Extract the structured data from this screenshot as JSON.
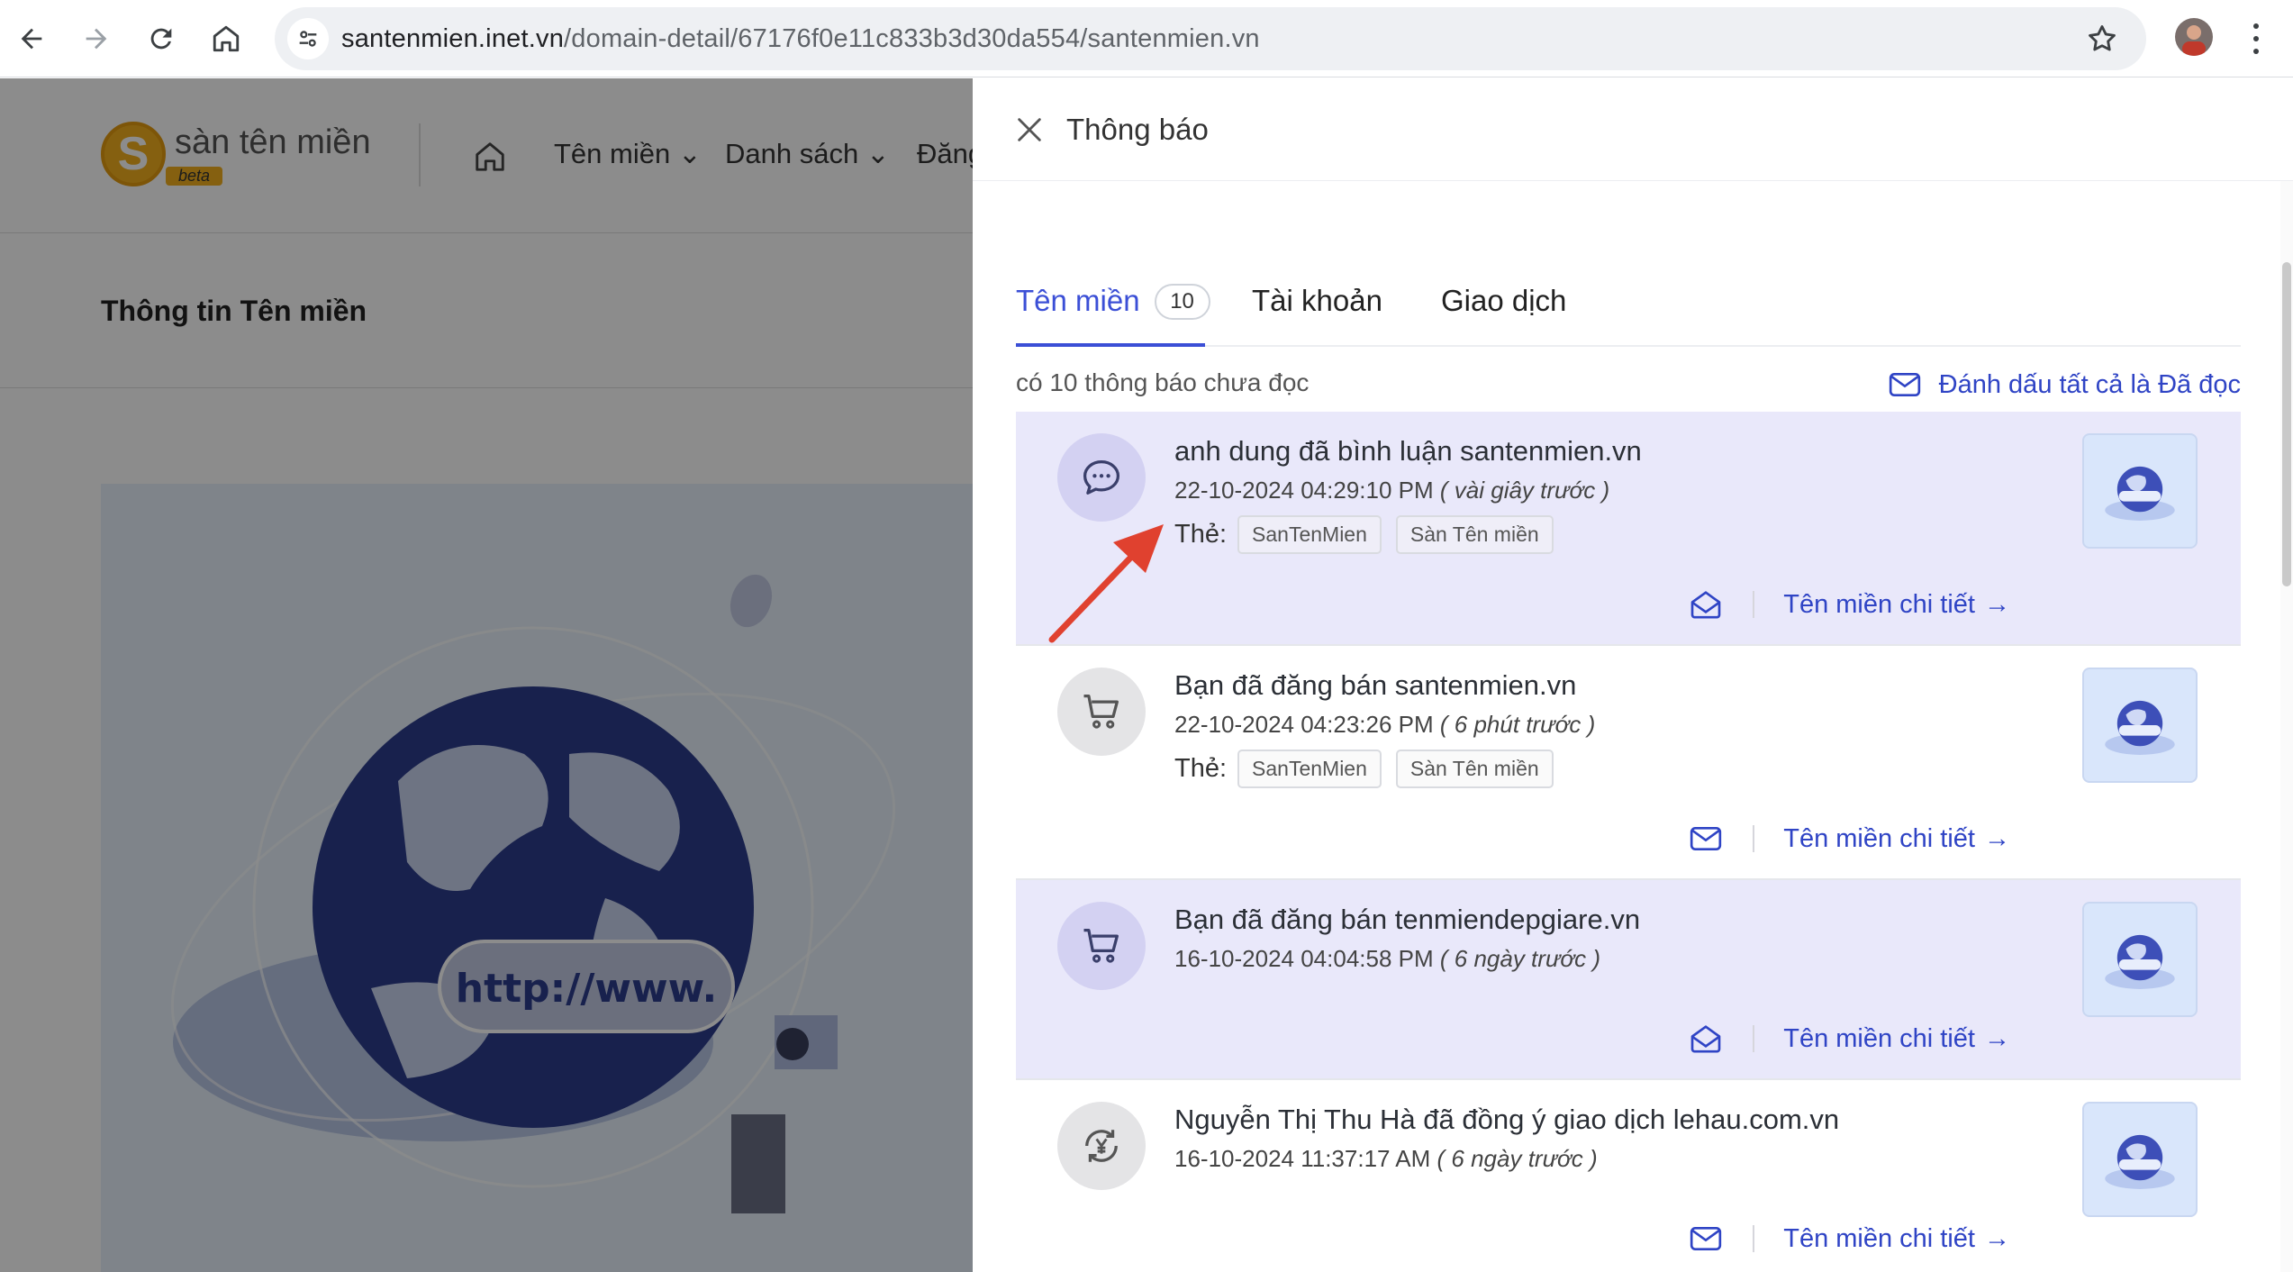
{
  "browser": {
    "url_host": "santenmien.inet.vn",
    "url_path": "/domain-detail/67176f0e11c833b3d30da554/santenmien.vn"
  },
  "site": {
    "logo_letter": "S",
    "logo_text": "sàn tên miền",
    "logo_badge": "beta",
    "menu": [
      "Tên miền",
      "Danh sách",
      "Đăng"
    ],
    "page_title": "Thông tin Tên miền",
    "hero_text": "http://www."
  },
  "drawer": {
    "title": "Thông báo",
    "tabs": [
      {
        "label": "Tên miền",
        "badge": "10",
        "active": true
      },
      {
        "label": "Tài khoản",
        "active": false
      },
      {
        "label": "Giao dịch",
        "active": false
      }
    ],
    "unread_text": "có 10 thông báo chưa đọc",
    "mark_all_label": "Đánh dấu tất cả là Đã đọc",
    "tags_label": "Thẻ:",
    "detail_label": "Tên miền chi tiết",
    "notifications": [
      {
        "icon": "chat-icon",
        "title": "anh dung đã bình luận santenmien.vn",
        "datetime": "22-10-2024 04:29:10 PM",
        "relative": "( vài giây trước )",
        "tags": [
          "SanTenMien",
          "Sàn Tên miền"
        ],
        "unread": true,
        "envelope": "envelope-open-icon"
      },
      {
        "icon": "cart-icon",
        "title": "Bạn đã đăng bán santenmien.vn",
        "datetime": "22-10-2024 04:23:26 PM",
        "relative": "( 6 phút trước )",
        "tags": [
          "SanTenMien",
          "Sàn Tên miền"
        ],
        "unread": false,
        "envelope": "envelope-icon"
      },
      {
        "icon": "cart-icon",
        "title": "Bạn đã đăng bán tenmiendepgiare.vn",
        "datetime": "16-10-2024 04:04:58 PM",
        "relative": "( 6 ngày trước )",
        "tags": [],
        "unread": true,
        "envelope": "envelope-open-icon"
      },
      {
        "icon": "yen-exchange-icon",
        "title": "Nguyễn Thị Thu Hà đã đồng ý giao dịch lehau.com.vn",
        "datetime": "16-10-2024 11:37:17 AM",
        "relative": "( 6 ngày trước )",
        "tags": [],
        "unread": false,
        "envelope": "envelope-icon"
      }
    ]
  },
  "colors": {
    "accent": "#3b4fd6",
    "unread_bg": "#e9e8fa",
    "annotation_arrow": "#e0412f"
  }
}
